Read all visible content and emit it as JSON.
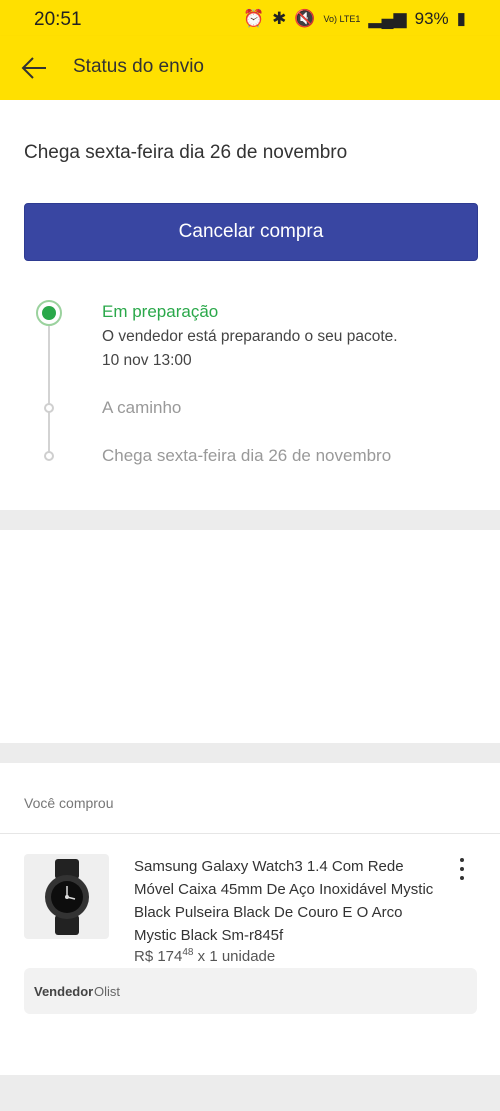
{
  "status_bar": {
    "time": "20:51",
    "battery": "93%",
    "network": "Vo) LTE1"
  },
  "app_bar": {
    "title": "Status do envio"
  },
  "shipment": {
    "arrival": "Chega sexta-feira dia 26 de novembro",
    "cancel_label": "Cancelar compra",
    "steps": [
      {
        "title": "Em preparação",
        "desc": "O vendedor está preparando o seu pacote.",
        "time": "10 nov 13:00",
        "state": "active"
      },
      {
        "title": "A caminho",
        "state": "pending"
      },
      {
        "title": "Chega sexta-feira dia 26 de novembro",
        "state": "pending"
      }
    ]
  },
  "purchase": {
    "heading": "Você comprou",
    "product_title": "Samsung Galaxy Watch3 1.4 Com Rede Móvel Caixa 45mm De Aço Inoxidável Mystic Black Pulseira Black De Couro E O Arco Mystic Black Sm-r845f",
    "price_prefix": "R$ 174",
    "price_cents": "48",
    "quantity_text": " x 1 unidade",
    "seller_label": "Vendedor",
    "seller_name": "Olist"
  },
  "colors": {
    "brand_yellow": "#ffe000",
    "button_blue": "#3946a2",
    "success_green": "#2aa84a"
  }
}
